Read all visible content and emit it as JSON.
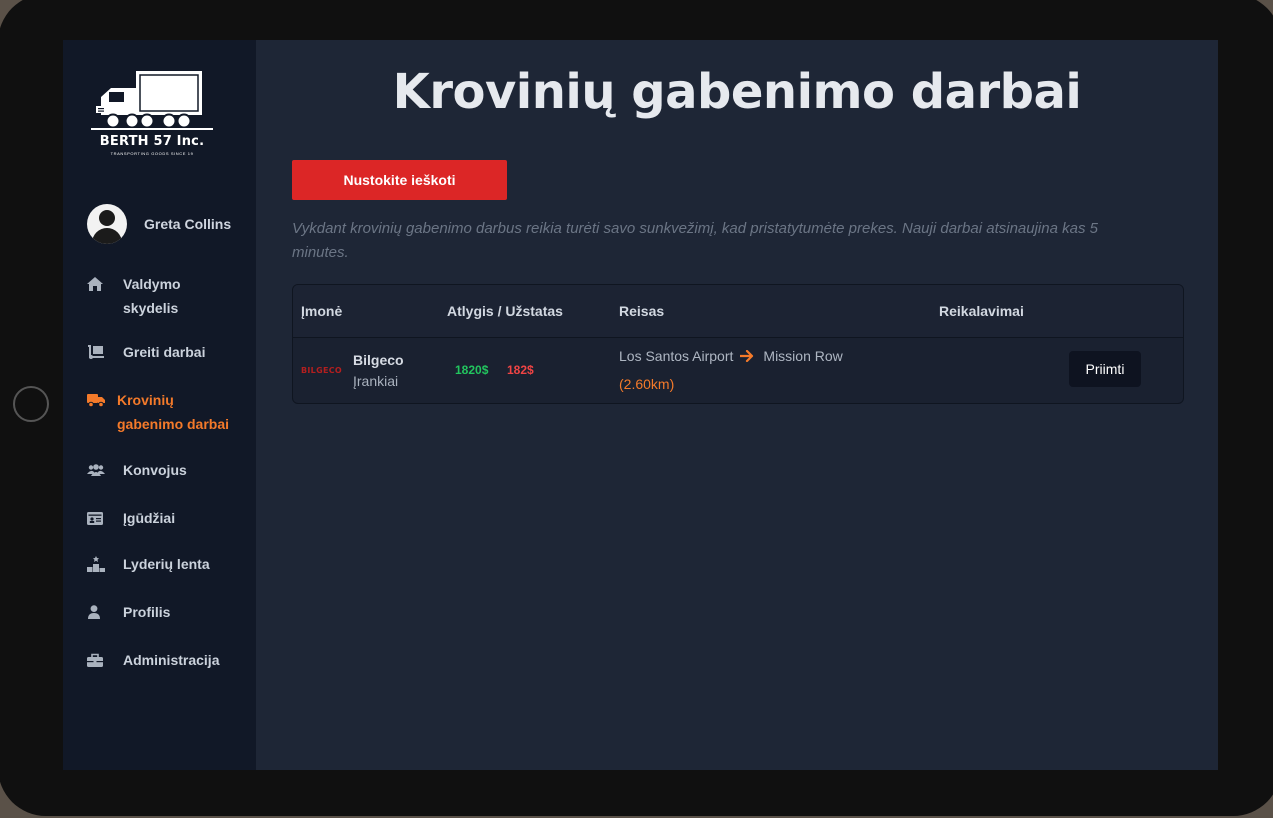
{
  "brand": {
    "name": "BERTH 57 Inc.",
    "tagline": "TRANSPORTING GOODS SINCE 19"
  },
  "user": {
    "name": "Greta Collins"
  },
  "nav": {
    "items": [
      {
        "label": "Valdymo skydelis",
        "icon": "home-icon"
      },
      {
        "label": "Greiti darbai",
        "icon": "dolly-icon"
      },
      {
        "label": "Krovinių gabenimo darbai",
        "icon": "truck-icon",
        "active": true
      },
      {
        "label": "Konvojus",
        "icon": "users-icon"
      },
      {
        "label": "Įgūdžiai",
        "icon": "id-card-icon"
      },
      {
        "label": "Lyderių lenta",
        "icon": "podium-icon"
      },
      {
        "label": "Profilis",
        "icon": "user-icon"
      },
      {
        "label": "Administracija",
        "icon": "toolbox-icon"
      }
    ]
  },
  "page": {
    "title": "Krovinių gabenimo darbai",
    "stop_button": "Nustokite ieškoti",
    "description": "Vykdant krovinių gabenimo darbus reikia turėti savo sunkvežimį, kad pristatytumėte prekes. Nauji darbai atsinaujina kas 5 minutes."
  },
  "table": {
    "headers": {
      "company": "Įmonė",
      "reward": "Atlygis / Užstatas",
      "route": "Reisas",
      "requirements": "Reikalavimai"
    },
    "rows": [
      {
        "company_logo_text": "BILGECO",
        "company": "Bilgeco",
        "cargo": "Įrankiai",
        "reward": "1820$",
        "deposit": "182$",
        "from": "Los Santos Airport",
        "to": "Mission Row",
        "distance": "(2.60km)",
        "accept_label": "Priimti"
      }
    ]
  },
  "colors": {
    "accent": "#f47a2a",
    "danger": "#dc2626",
    "reward": "#22c55e",
    "deposit": "#ef4444"
  }
}
